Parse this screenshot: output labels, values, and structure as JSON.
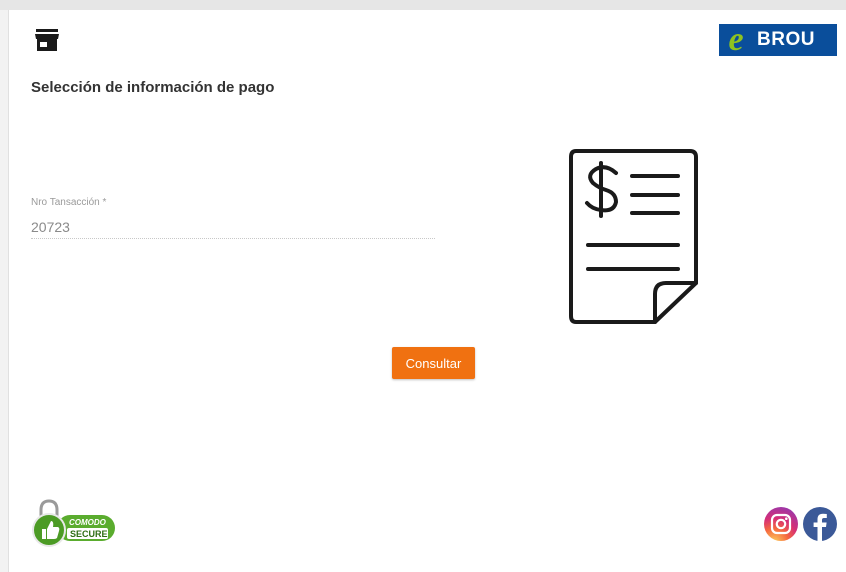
{
  "header": {
    "store_icon": "store-icon",
    "logo": {
      "prefix": "e",
      "text": "BROU",
      "bg_color": "#0a4e9b",
      "accent_color": "#8fc31f"
    }
  },
  "main": {
    "title": "Selección de información de pago",
    "transaction_field": {
      "label": "Nro Tansacción *",
      "value": "20723"
    },
    "illustration_icon": "receipt-dollar-icon",
    "submit_label": "Consultar",
    "accent_color": "#f07111"
  },
  "footer": {
    "badge": {
      "top": "COMODO",
      "bottom": "SECURE"
    },
    "social": [
      "instagram-icon",
      "facebook-icon"
    ]
  }
}
